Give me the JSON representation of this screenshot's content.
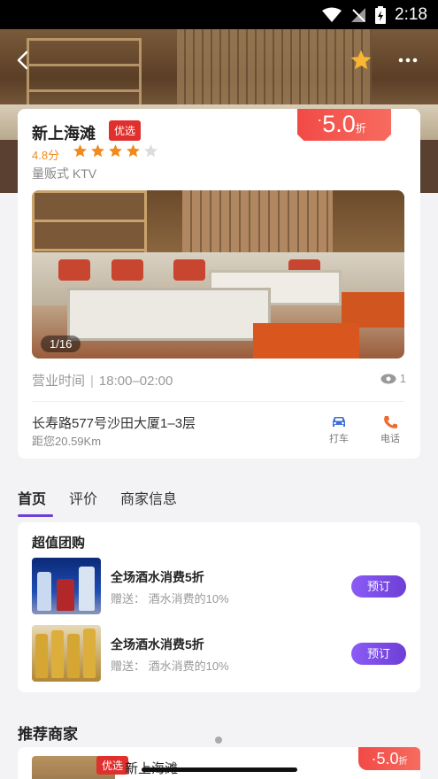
{
  "status_bar": {
    "time": "2:18"
  },
  "shop": {
    "name": "新上海滩",
    "badge": "优选",
    "rating": "4.8分",
    "stars": 4,
    "type": "量贩式 KTV",
    "discount_value": "5.0",
    "discount_unit": "折",
    "photo_counter": "1/16",
    "hours_label": "营业时间",
    "hours_sep": "|",
    "hours": "18:00–02:00",
    "views": "1",
    "address": "长寿路577号沙田大厦1–3层",
    "distance": "距您20.59Km",
    "taxi_label": "打车",
    "phone_label": "电话"
  },
  "tabs": [
    {
      "label": "首页",
      "active": true
    },
    {
      "label": "评价",
      "active": false
    },
    {
      "label": "商家信息",
      "active": false
    }
  ],
  "deals": {
    "title": "超值团购",
    "items": [
      {
        "name": "全场酒水消费5折",
        "gift": "赠送：  酒水消费的10%",
        "button": "预订"
      },
      {
        "name": "全场酒水消费5折",
        "gift": "赠送：  酒水消费的10%",
        "button": "预订"
      }
    ]
  },
  "recommend": {
    "title": "推荐商家",
    "items": [
      {
        "name": "新上海滩",
        "badge": "优选",
        "discount_value": "5.0",
        "discount_unit": "折"
      }
    ]
  },
  "colors": {
    "accent": "#6d3fd6",
    "discount_red": "#f24a46",
    "rating_orange": "#f08a1c"
  }
}
